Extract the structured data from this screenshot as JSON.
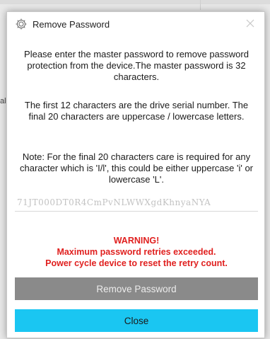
{
  "background": {
    "fragment_text": "al"
  },
  "dialog": {
    "title": "Remove Password",
    "app_icon": "gear-icon",
    "close_icon": "close-icon",
    "message_1": "Please enter the master password to remove password protection from the device.The master password is 32 characters.",
    "message_2": "The first 12 characters are the drive serial number. The final 20 characters are uppercase / lowercase letters.",
    "message_3": "Note: For the final 20 characters care is required for any character which is 'I/l', this could be either uppercase 'i' or lowercase 'L'.",
    "password_value": "71JT000DT0R4CmPvNLWWXgdKhnyaNYA",
    "warning_title": "WARNING!",
    "warning_line_1": "Maximum password retries exceeded.",
    "warning_line_2": "Power cycle device to reset the retry count.",
    "remove_button_label": "Remove Password",
    "close_button_label": "Close"
  },
  "colors": {
    "warning": "#e0201f",
    "close_button": "#1ac6f2",
    "remove_button_disabled": "#8a8a8a"
  }
}
